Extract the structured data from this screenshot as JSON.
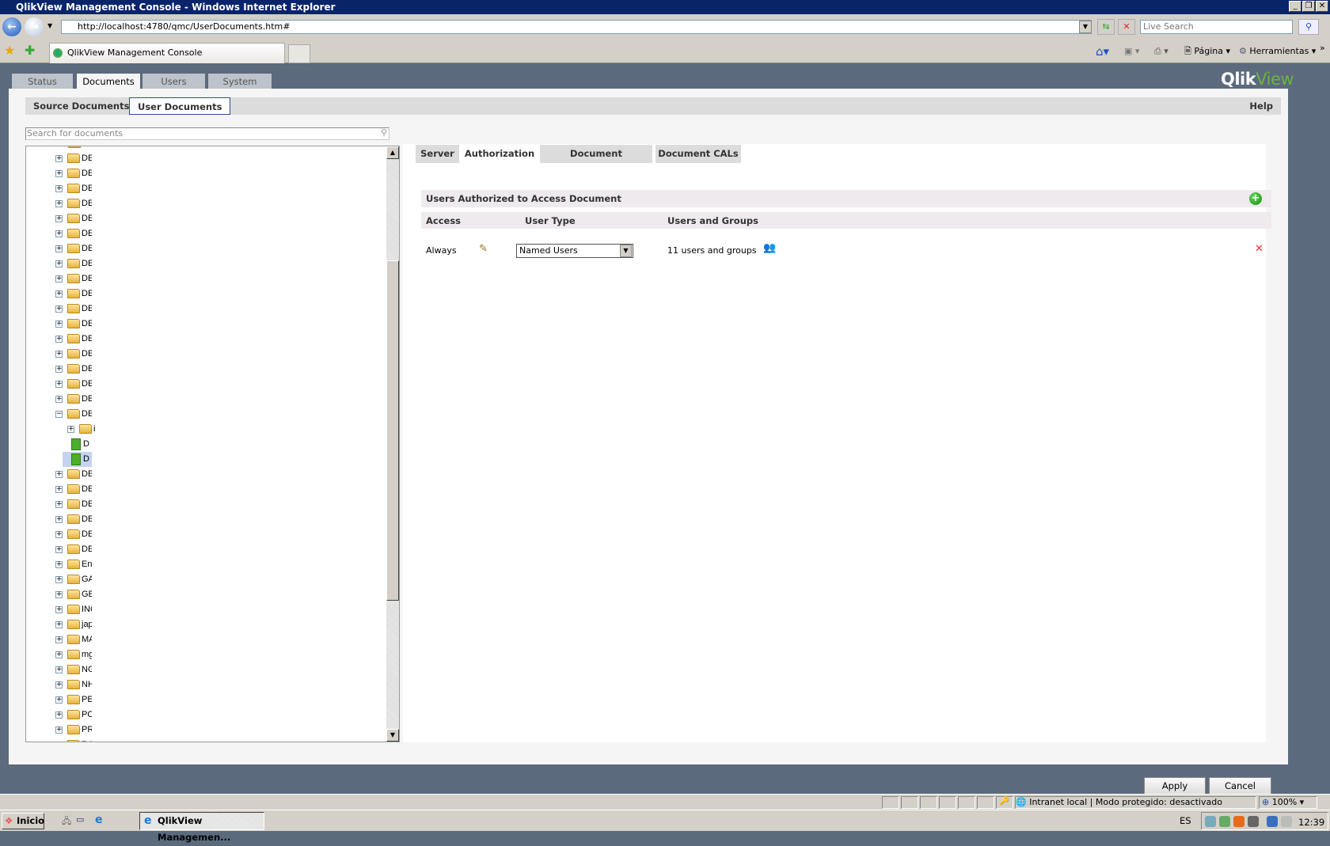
{
  "browser": {
    "title": "QlikView Management Console - Windows Internet Explorer",
    "url": "http://localhost:4780/qmc/UserDocuments.htm#",
    "search_placeholder": "Live Search",
    "tab_title": "QlikView Management Console",
    "page_menu": "Página",
    "tools_menu": "Herramientas"
  },
  "app": {
    "logo": "QlikView",
    "logo_a": "Qlik",
    "logo_b": "View",
    "main_tabs": [
      {
        "label": "Status"
      },
      {
        "label": "Documents"
      },
      {
        "label": "Users"
      },
      {
        "label": "System"
      }
    ],
    "sub_tabs": [
      {
        "label": "Source Documents"
      },
      {
        "label": "User Documents"
      }
    ],
    "help": "Help",
    "search_placeholder": "Search for documents",
    "tree": [
      {
        "label": "DEM",
        "type": "folder",
        "level": 0,
        "state": "plus"
      },
      {
        "label": "DEM",
        "type": "folder",
        "level": 0,
        "state": "plus"
      },
      {
        "label": "DEM",
        "type": "folder",
        "level": 0,
        "state": "plus"
      },
      {
        "label": "DEM",
        "type": "folder",
        "level": 0,
        "state": "plus"
      },
      {
        "label": "DEM",
        "type": "folder",
        "level": 0,
        "state": "plus"
      },
      {
        "label": "DEM",
        "type": "folder",
        "level": 0,
        "state": "plus"
      },
      {
        "label": "DEM",
        "type": "folder",
        "level": 0,
        "state": "plus"
      },
      {
        "label": "DEM",
        "type": "folder",
        "level": 0,
        "state": "plus"
      },
      {
        "label": "DEM",
        "type": "folder",
        "level": 0,
        "state": "plus"
      },
      {
        "label": "DEM",
        "type": "folder",
        "level": 0,
        "state": "plus"
      },
      {
        "label": "DEM",
        "type": "folder",
        "level": 0,
        "state": "plus"
      },
      {
        "label": "DEM",
        "type": "folder",
        "level": 0,
        "state": "plus"
      },
      {
        "label": "DEM",
        "type": "folder",
        "level": 0,
        "state": "plus"
      },
      {
        "label": "DEM",
        "type": "folder",
        "level": 0,
        "state": "plus"
      },
      {
        "label": "DEM",
        "type": "folder",
        "level": 0,
        "state": "plus"
      },
      {
        "label": "DEM",
        "type": "folder",
        "level": 0,
        "state": "plus"
      },
      {
        "label": "DEM",
        "type": "folder",
        "level": 0,
        "state": "plus"
      },
      {
        "label": "DEM",
        "type": "folder",
        "level": 0,
        "state": "minus"
      },
      {
        "label": "i",
        "type": "folder",
        "level": 1,
        "state": "plus"
      },
      {
        "label": "D",
        "type": "doc",
        "level": 1
      },
      {
        "label": "D",
        "type": "doc",
        "level": 1,
        "selected": true
      },
      {
        "label": "DEM",
        "type": "folder",
        "level": 0,
        "state": "plus"
      },
      {
        "label": "DEM",
        "type": "folder",
        "level": 0,
        "state": "plus"
      },
      {
        "label": "DEM",
        "type": "folder",
        "level": 0,
        "state": "plus"
      },
      {
        "label": "DEM",
        "type": "folder",
        "level": 0,
        "state": "plus"
      },
      {
        "label": "DEM",
        "type": "folder",
        "level": 0,
        "state": "plus"
      },
      {
        "label": "DEM",
        "type": "folder",
        "level": 0,
        "state": "plus"
      },
      {
        "label": "Env",
        "type": "folder",
        "level": 0,
        "state": "plus"
      },
      {
        "label": "GAL",
        "type": "folder",
        "level": 0,
        "state": "plus"
      },
      {
        "label": "GEC",
        "type": "folder",
        "level": 0,
        "state": "plus"
      },
      {
        "label": "ING",
        "type": "folder",
        "level": 0,
        "state": "plus"
      },
      {
        "label": "japa",
        "type": "folder",
        "level": 0,
        "state": "plus"
      },
      {
        "label": "MAR",
        "type": "folder",
        "level": 0,
        "state": "plus"
      },
      {
        "label": "mgc",
        "type": "folder",
        "level": 0,
        "state": "plus"
      },
      {
        "label": "NGI",
        "type": "folder",
        "level": 0,
        "state": "plus"
      },
      {
        "label": "NHS",
        "type": "folder",
        "level": 0,
        "state": "plus"
      },
      {
        "label": "PEL",
        "type": "folder",
        "level": 0,
        "state": "plus"
      },
      {
        "label": "POM",
        "type": "folder",
        "level": 0,
        "state": "plus"
      },
      {
        "label": "PRU",
        "type": "folder",
        "level": 0,
        "state": "plus"
      },
      {
        "label": "RAMIRO",
        "type": "folder",
        "level": 0,
        "state": "plus"
      }
    ],
    "doc_tabs": [
      {
        "label": "Server"
      },
      {
        "label": "Authorization"
      },
      {
        "label": "Document Information"
      },
      {
        "label": "Document CALs"
      }
    ],
    "auth": {
      "section_title": "Users Authorized to Access Document",
      "col_access": "Access",
      "col_user_type": "User Type",
      "col_users": "Users and Groups",
      "rows": [
        {
          "access": "Always",
          "user_type": "Named Users",
          "users": "11 users and groups"
        }
      ]
    },
    "apply": "Apply",
    "cancel": "Cancel"
  },
  "status": {
    "zone": "Intranet local | Modo protegido: desactivado",
    "zoom": "100%"
  },
  "taskbar": {
    "start": "Inicio",
    "task": "QlikView Managemen...",
    "lang": "ES",
    "clock": "12:39"
  }
}
